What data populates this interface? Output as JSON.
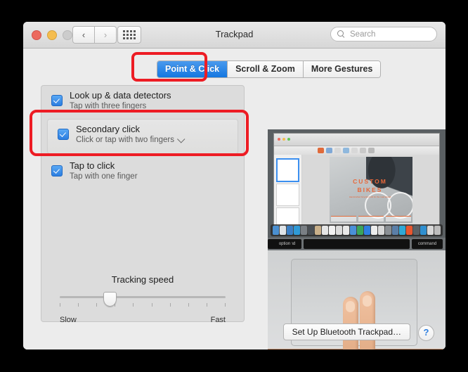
{
  "window": {
    "title": "Trackpad",
    "traffic": {
      "close": "close-button",
      "minimize": "minimize-button",
      "zoom": "zoom-button"
    },
    "nav": {
      "back": "‹",
      "forward": "›"
    },
    "show_all": "show-all-grid"
  },
  "search": {
    "placeholder": "Search",
    "value": ""
  },
  "tabs": [
    {
      "label": "Point & Click",
      "active": true
    },
    {
      "label": "Scroll & Zoom",
      "active": false
    },
    {
      "label": "More Gestures",
      "active": false
    }
  ],
  "options": [
    {
      "title": "Look up & data detectors",
      "sub": "Tap with three fingers",
      "checked": true,
      "has_dropdown": false
    },
    {
      "title": "Secondary click",
      "sub": "Click or tap with two fingers",
      "checked": true,
      "has_dropdown": true,
      "selected": true
    },
    {
      "title": "Tap to click",
      "sub": "Tap with one finger",
      "checked": true,
      "has_dropdown": false
    }
  ],
  "tracking": {
    "label": "Tracking speed",
    "slow_label": "Slow",
    "fast_label": "Fast",
    "tick_count": 10,
    "value_percent": 30
  },
  "preview": {
    "document_title_line1": "CUSTOM",
    "document_title_line2": "BIKES",
    "document_subtitle": "Handcrafted bicycles built for the road ahead",
    "keys": [
      "command",
      "",
      "command",
      "option"
    ]
  },
  "footer": {
    "bluetooth_button": "Set Up Bluetooth Trackpad…",
    "help_button": "?"
  },
  "annotations": {
    "accent_color": "#ed1c24",
    "highlighted_tab": "Point & Click",
    "highlighted_option": "Secondary click"
  },
  "colors": {
    "accent_blue": "#1477e0",
    "checkbox_blue": "#2b7de0",
    "panel_bg": "#dcdcdc",
    "window_bg": "#ececec",
    "annotation_red": "#ed1c24"
  }
}
